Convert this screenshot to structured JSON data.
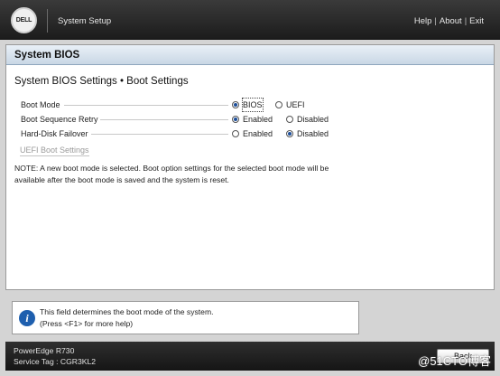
{
  "header": {
    "logo_text": "DELL",
    "title": "System Setup",
    "links": {
      "help": "Help",
      "about": "About",
      "exit": "Exit",
      "separator": "|"
    }
  },
  "section": {
    "title": "System BIOS"
  },
  "page": {
    "heading": "System BIOS Settings • Boot Settings"
  },
  "settings": [
    {
      "label": "Boot Mode",
      "options": [
        "BIOS",
        "UEFI"
      ],
      "selected": "BIOS"
    },
    {
      "label": "Boot Sequence Retry",
      "options": [
        "Enabled",
        "Disabled"
      ],
      "selected": "Enabled"
    },
    {
      "label": "Hard-Disk Failover",
      "options": [
        "Enabled",
        "Disabled"
      ],
      "selected": "Disabled"
    }
  ],
  "uefi_boot_settings_label": "UEFI Boot Settings",
  "note": "NOTE: A new boot mode is selected. Boot option settings for the selected boot mode will be available after the boot mode is saved and the system is reset.",
  "help": {
    "line1": "This field determines the boot mode of the system.",
    "line2": "(Press <F1> for more help)"
  },
  "footer": {
    "model": "PowerEdge R730",
    "service_tag": "Service Tag : CGR3KL2",
    "back_label": "Back"
  },
  "watermark": "@51CTO博客",
  "colors": {
    "accent": "#1e5fae",
    "section_bar": "#c9d7e5",
    "top_bar": "#1c1c1c"
  }
}
